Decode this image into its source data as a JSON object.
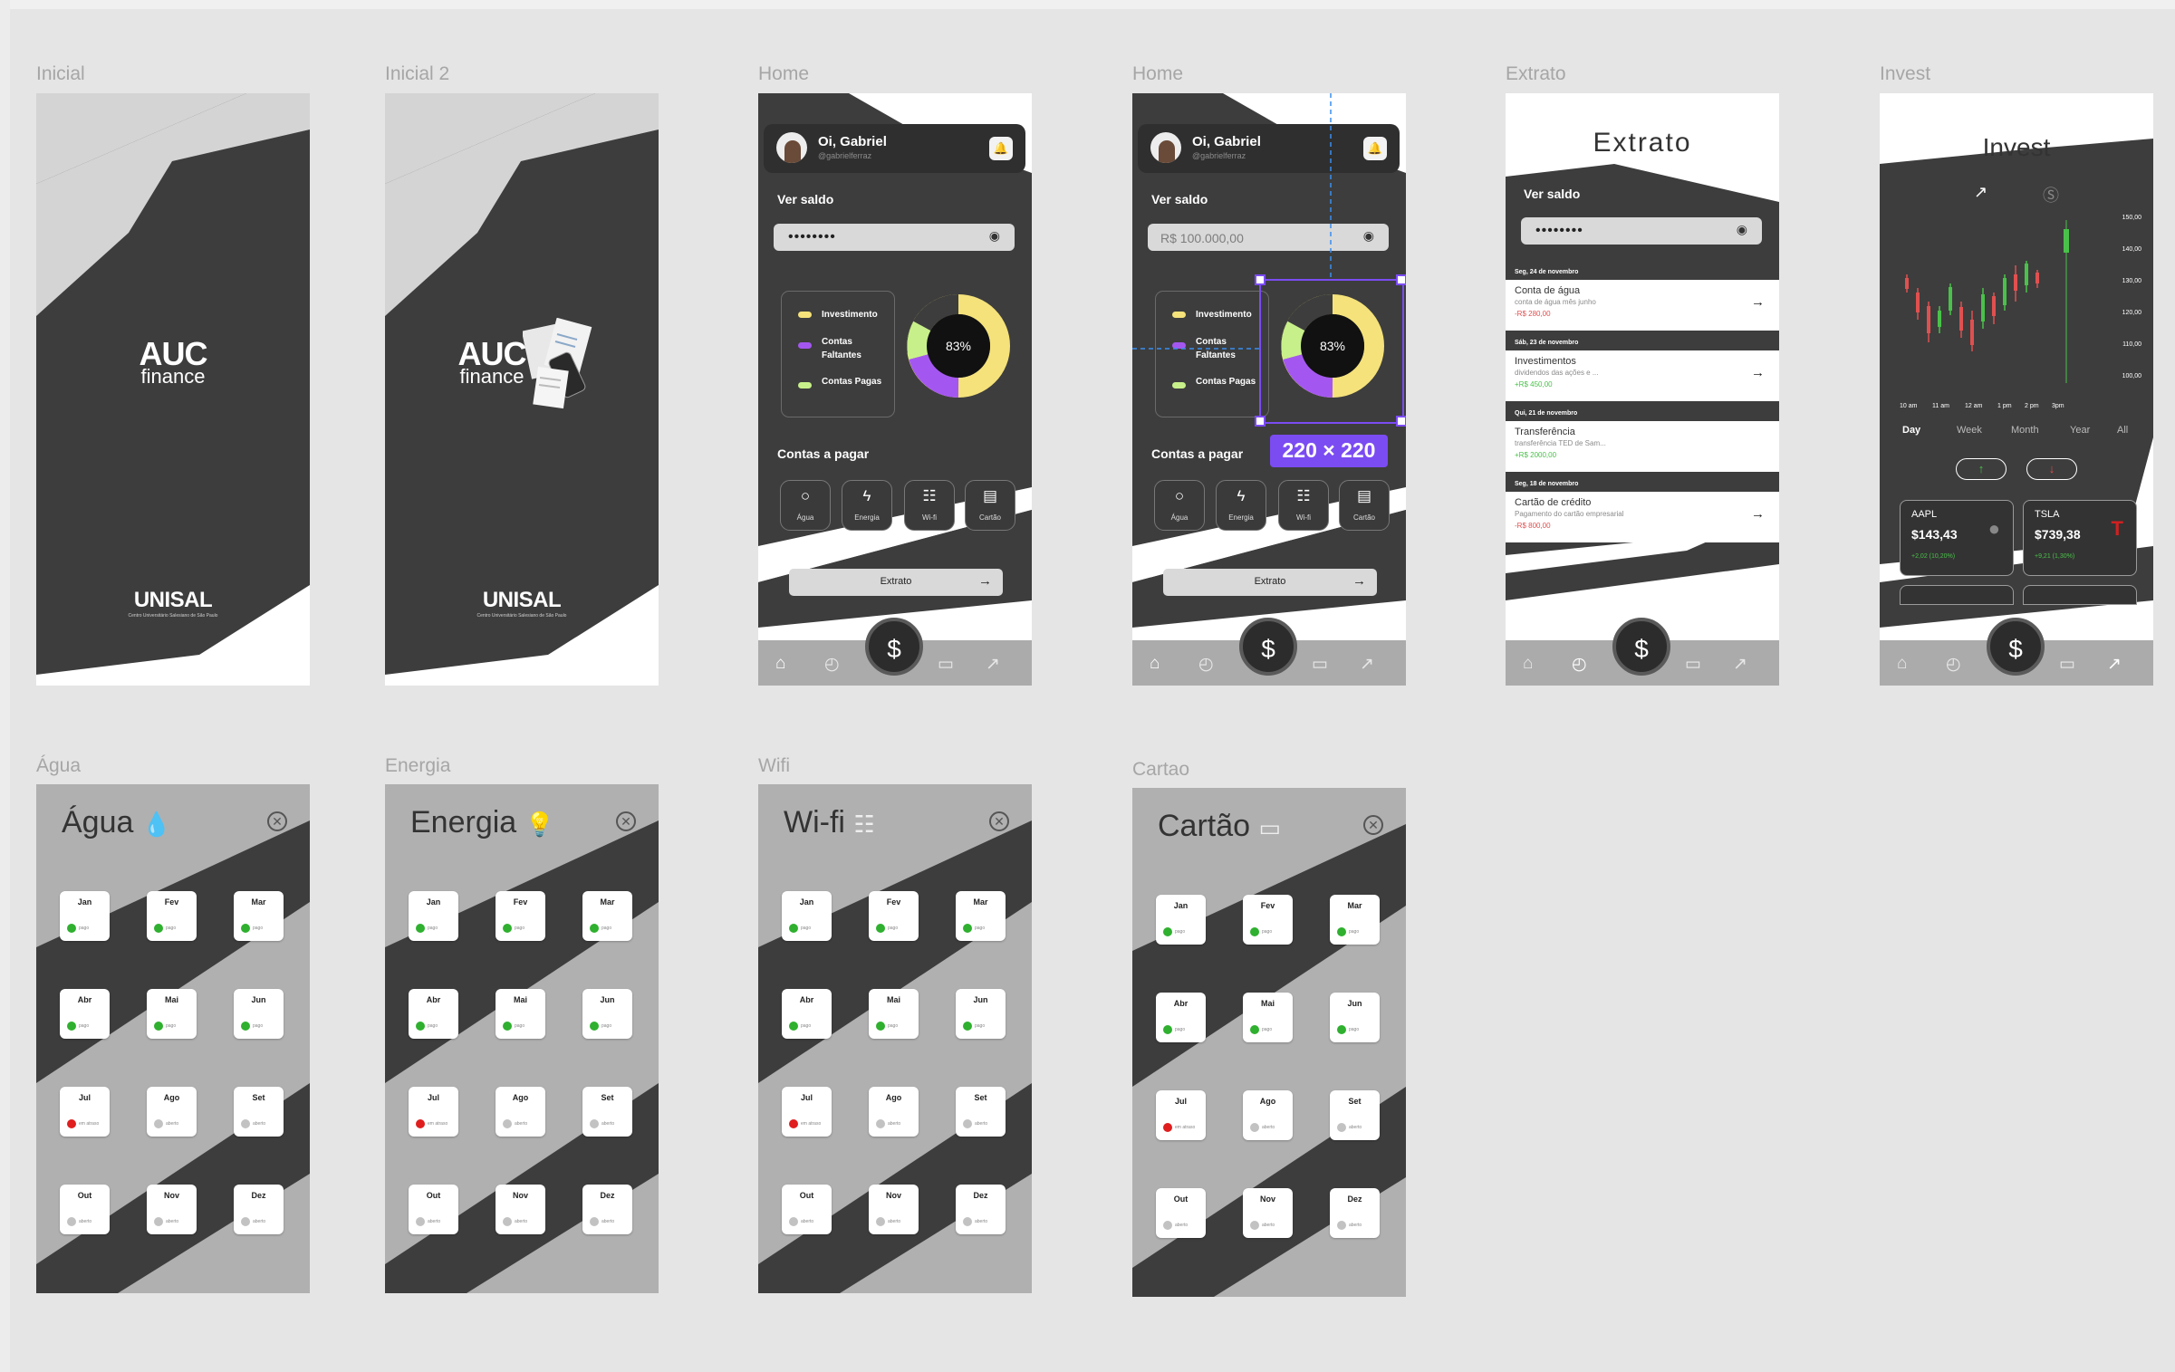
{
  "frames": {
    "inicial": {
      "label": "Inicial",
      "logo_auc": "AUC",
      "logo_finance": "finance",
      "unisal": "UNISAL",
      "unisal_sub": "Centro Universitário Salesiano de São Paulo"
    },
    "inicial2": {
      "label": "Inicial 2",
      "logo_auc": "AUC",
      "logo_finance": "finance",
      "unisal": "UNISAL",
      "unisal_sub": "Centro Universitário Salesiano de São Paulo"
    },
    "home": {
      "label": "Home",
      "greeting": "Oi, Gabriel",
      "handle": "@gabrielferraz",
      "ver_saldo": "Ver saldo",
      "password_mask": "••••••••",
      "legend": [
        "Investimento",
        "Contas Faltantes",
        "Contas Pagas"
      ],
      "donut_label": "83%",
      "contas_title": "Contas a pagar",
      "contas": [
        "Água",
        "Energia",
        "Wi-fi",
        "Cartão"
      ],
      "extrato_button": "Extrato"
    },
    "home2": {
      "label": "Home",
      "greeting": "Oi, Gabriel",
      "handle": "@gabrielferraz",
      "ver_saldo": "Ver saldo",
      "balance": "R$ 100.000,00",
      "legend": [
        "Investimento",
        "Contas Faltantes",
        "Contas Pagas"
      ],
      "donut_label": "83%",
      "contas_title": "Contas a pagar",
      "contas": [
        "Água",
        "Energia",
        "Wi-fi",
        "Cartão"
      ],
      "extrato_button": "Extrato",
      "measure_badge": "220 × 220"
    },
    "extrato": {
      "label": "Extrato",
      "title": "Extrato",
      "ver_saldo": "Ver saldo",
      "password_mask": "••••••••",
      "groups": [
        {
          "date": "Seg, 24 de novembro",
          "title": "Conta de água",
          "desc": "conta de água mês junho",
          "amount": "-R$ 280,00",
          "amount_color": "#e05050"
        },
        {
          "date": "Sáb, 23 de novembro",
          "title": "Investimentos",
          "desc": "dividendos das ações e ...",
          "amount": "+R$ 450,00",
          "amount_color": "#4ac14a"
        },
        {
          "date": "Qui, 21 de novembro",
          "title": "Transferência",
          "desc": "transferência TED de Sam...",
          "amount": "+R$ 2000,00",
          "amount_color": "#4ac14a"
        },
        {
          "date": "Seg, 18 de novembro",
          "title": "Cartão de crédito",
          "desc": "Pagamento do cartão empresarial",
          "amount": "-R$ 800,00",
          "amount_color": "#e05050"
        }
      ]
    },
    "invest": {
      "label": "Invest",
      "title": "Invest",
      "y_ticks": [
        "150,00",
        "140,00",
        "130,00",
        "120,00",
        "110,00",
        "100,00"
      ],
      "x_ticks": [
        "10 am",
        "11 am",
        "12 am",
        "1 pm",
        "2 pm",
        "3pm"
      ],
      "ranges": [
        "Day",
        "Week",
        "Month",
        "Year",
        "All"
      ],
      "selected_range": "Day",
      "stocks": [
        {
          "ticker": "AAPL",
          "price": "$143,43",
          "change": "+2,02 (10,20%)"
        },
        {
          "ticker": "TSLA",
          "price": "$739,38",
          "change": "+9,21 (1,30%)"
        }
      ]
    },
    "agua": {
      "label": "Água",
      "title": "Água"
    },
    "energia": {
      "label": "Energia",
      "title": "Energia"
    },
    "wifi": {
      "label": "Wifi",
      "title": "Wi-fi"
    },
    "cartao": {
      "label": "Cartao",
      "title": "Cartão"
    }
  },
  "months": [
    "Jan",
    "Fev",
    "Mar",
    "Abr",
    "Mai",
    "Jun",
    "Jul",
    "Ago",
    "Set",
    "Out",
    "Nov",
    "Dez"
  ],
  "status": {
    "paid": "pago",
    "late": "em atraso",
    "open": "aberto"
  },
  "nav_icons": [
    "home-icon",
    "history-icon",
    "dollar-icon",
    "wallet-icon",
    "chart-icon"
  ],
  "colors": {
    "dark": "#3d3d3d",
    "light_gray": "#b0b0b0",
    "yellow": "#f5e27a",
    "purple": "#a457f0",
    "green_light": "#c8f08a",
    "paid_dot": "#2fb02f",
    "late_dot": "#e01e1e",
    "open_dot": "#c2c2c2"
  }
}
